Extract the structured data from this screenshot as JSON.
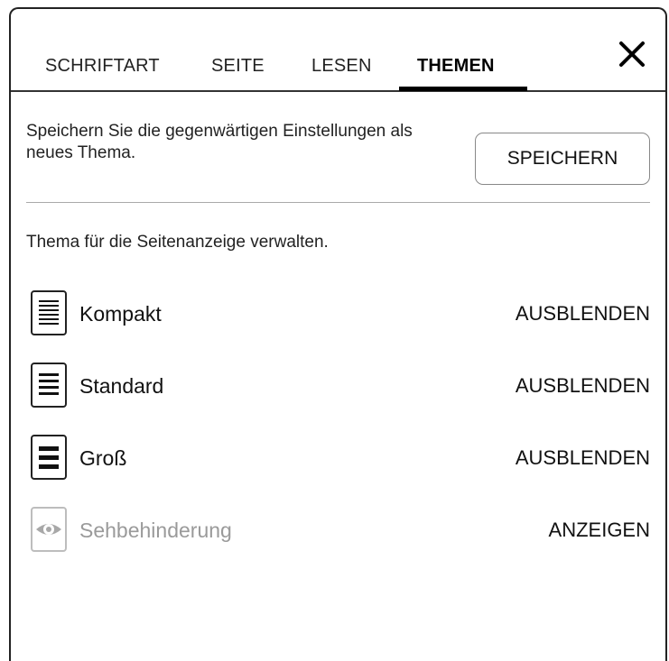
{
  "tabs": [
    {
      "label": "SCHRIFTART"
    },
    {
      "label": "SEITE"
    },
    {
      "label": "LESEN"
    },
    {
      "label": "THEMEN",
      "active": true
    }
  ],
  "close_icon": "close-icon",
  "save_section": {
    "text": "Speichern Sie die gegenwärtigen Einstellungen als neues Thema.",
    "button_label": "SPEICHERN"
  },
  "manage_text": "Thema für die Seitenanzeige verwalten.",
  "themes": [
    {
      "name": "Kompakt",
      "action": "AUSBLENDEN",
      "icon": "compact-lines-icon"
    },
    {
      "name": "Standard",
      "action": "AUSBLENDEN",
      "icon": "standard-lines-icon"
    },
    {
      "name": "Groß",
      "action": "AUSBLENDEN",
      "icon": "large-lines-icon"
    },
    {
      "name": "Sehbehinderung",
      "action": "ANZEIGEN",
      "icon": "eye-icon",
      "hidden": true
    }
  ],
  "colors": {
    "text": "#111111",
    "disabled_text": "#9a9a9a",
    "accent": "#000000"
  }
}
